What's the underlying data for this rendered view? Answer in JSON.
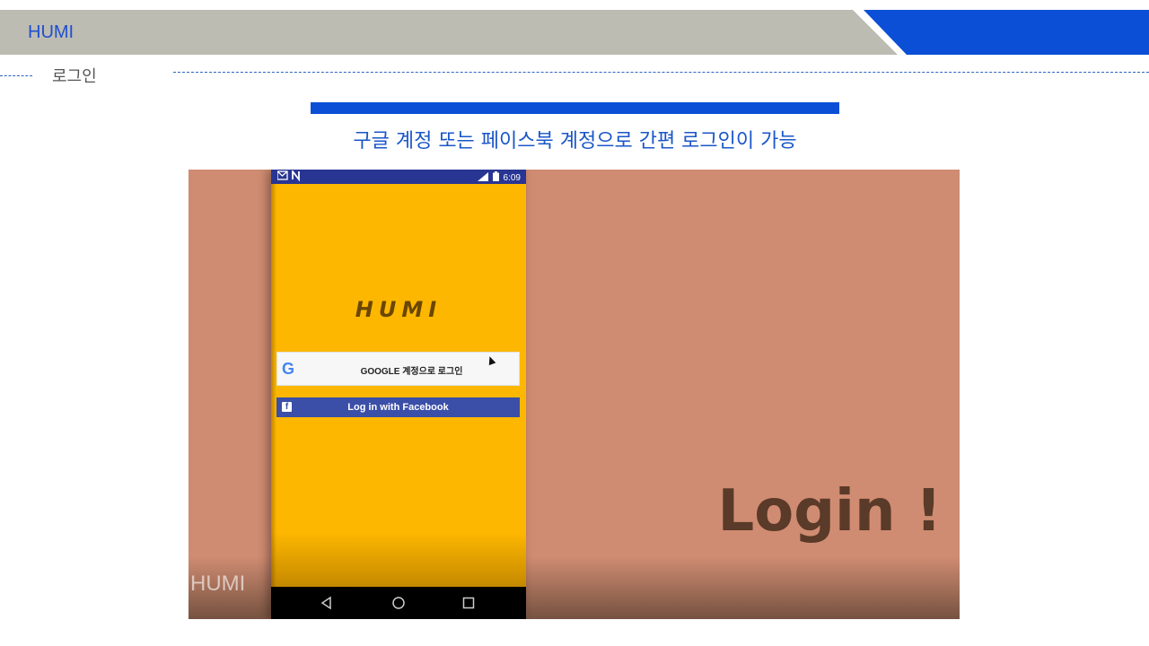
{
  "header": {
    "title": "HUMI",
    "accent_color": "#0a4fd6"
  },
  "section": {
    "label": "로그인"
  },
  "caption": "구글 계정 또는 페이스북 계정으로 간편 로그인이 가능",
  "video": {
    "watermark": "HUMI",
    "overlay_text": "Login !",
    "phone": {
      "status_bar": {
        "left_icons": "mail-icon, n-icon",
        "time": "6:09"
      },
      "app_title": "HUMI",
      "google_button": {
        "icon": "google-g-icon",
        "glyph": "G",
        "label": "GOOGLE 계정으로 로그인"
      },
      "facebook_button": {
        "icon": "facebook-icon",
        "glyph": "f",
        "label": "Log in with Facebook"
      },
      "nav": {
        "back_icon": "back-triangle-icon",
        "home_icon": "home-circle-icon",
        "recent_icon": "recent-square-icon"
      }
    }
  }
}
